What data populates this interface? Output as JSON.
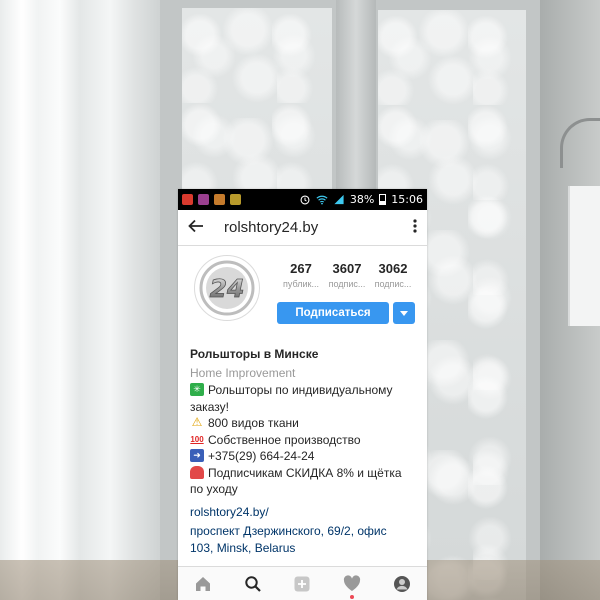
{
  "status_bar": {
    "battery": "38%",
    "time": "15:06",
    "notification_icons": [
      "video-app-icon",
      "instagram-app-icon",
      "photo-app-icon",
      "warning-app-icon"
    ],
    "system_icons": [
      "alarm-icon",
      "wifi-icon",
      "signal-icon",
      "battery-icon"
    ]
  },
  "header": {
    "username": "rolshtory24.by",
    "back_icon": "arrow-left-icon",
    "more_icon": "vertical-dots-icon"
  },
  "profile": {
    "avatar_text": "24",
    "stats": [
      {
        "value": "267",
        "label": "публик..."
      },
      {
        "value": "3607",
        "label": "подпис..."
      },
      {
        "value": "3062",
        "label": "подпис..."
      }
    ],
    "follow_label": "Подписаться",
    "dropdown_icon": "caret-down-icon"
  },
  "bio": {
    "name": "Рольшторы в Минске",
    "category": "Home Improvement",
    "lines": [
      {
        "emoji": "green-sparkle-emoji",
        "text": "Рольшторы по индивидуальному"
      },
      {
        "emoji": "",
        "text": "заказу!"
      },
      {
        "emoji": "warning-emoji",
        "text": "800 видов ткани"
      },
      {
        "emoji": "hundred-emoji",
        "text": "Собственное производство"
      },
      {
        "emoji": "phone-arrow-emoji",
        "text": "+375(29) 664-24-24"
      },
      {
        "emoji": "siren-emoji",
        "text": "Подписчикам СКИДКА 8% и щётка"
      },
      {
        "emoji": "",
        "text": "по уходу"
      }
    ],
    "link": "rolshtory24.by/",
    "address_line1": "проспект Дзержинского, 69/2, офис",
    "address_line2": "103, Minsk, Belarus"
  },
  "bottom_nav": [
    "home-icon",
    "search-icon",
    "add-icon",
    "heart-icon",
    "profile-avatar-icon"
  ],
  "colors": {
    "accent": "#3897f0",
    "link": "#003569",
    "notification_dot": "#ed4956"
  }
}
